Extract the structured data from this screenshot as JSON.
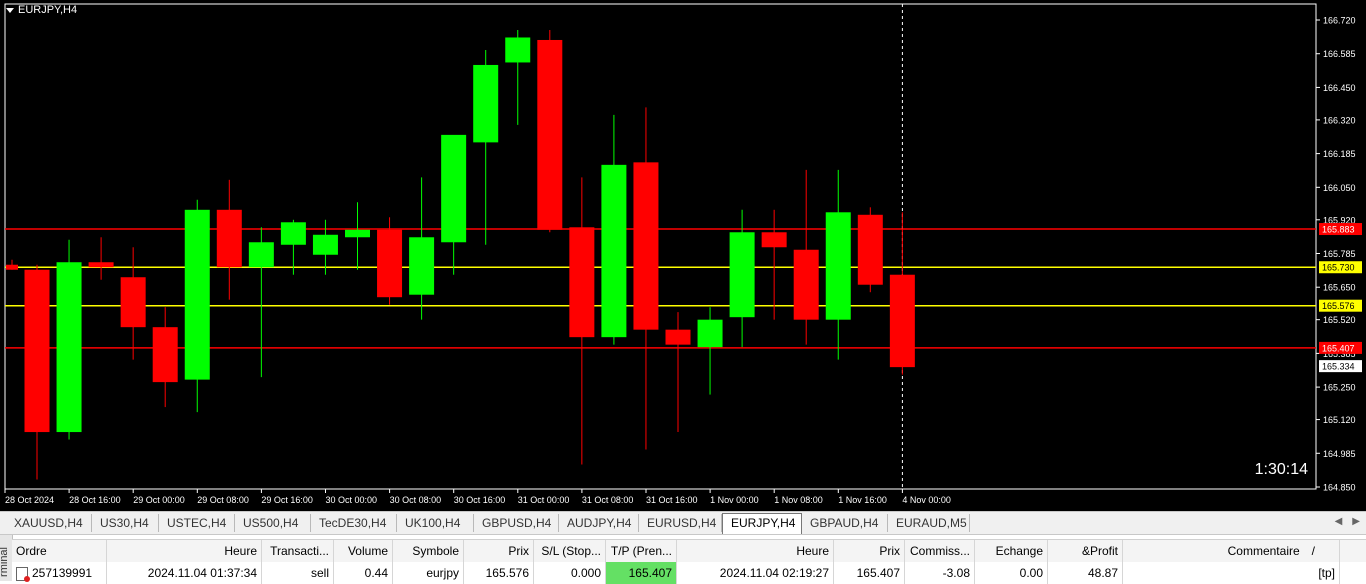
{
  "chart": {
    "symbol": "EURJPY,H4",
    "timer": "1:30:14",
    "price_axis": [
      "166.720",
      "166.585",
      "166.450",
      "166.320",
      "166.185",
      "166.050",
      "165.920",
      "165.785",
      "165.650",
      "165.520",
      "165.385",
      "165.250",
      "165.120",
      "164.985",
      "164.850"
    ],
    "x_labels": [
      "28 Oct 2024",
      "28 Oct 16:00",
      "29 Oct 00:00",
      "29 Oct 08:00",
      "29 Oct 16:00",
      "30 Oct 00:00",
      "30 Oct 08:00",
      "30 Oct 16:00",
      "31 Oct 00:00",
      "31 Oct 08:00",
      "31 Oct 16:00",
      "1 Nov 00:00",
      "1 Nov 08:00",
      "1 Nov 16:00",
      "4 Nov 00:00"
    ],
    "levels": [
      {
        "value": 165.883,
        "label": "165.883",
        "color": "#ff0000",
        "label_bg": "#ff0000",
        "label_color": "#ffffff"
      },
      {
        "value": 165.73,
        "label": "165.730",
        "color": "#ffff00",
        "label_bg": "#ffff00",
        "label_color": "#000000"
      },
      {
        "value": 165.576,
        "label": "165.576",
        "color": "#ffff00",
        "label_bg": "#ffff00",
        "label_color": "#000000"
      },
      {
        "value": 165.407,
        "label": "165.407",
        "color": "#ff0000",
        "label_bg": "#ff0000",
        "label_color": "#ffffff"
      }
    ],
    "current_price": {
      "value": 165.334,
      "label": "165.334"
    },
    "colors": {
      "bull": "#00ff00",
      "bear": "#ff0000",
      "background": "#000000",
      "grid": "#ffffff"
    }
  },
  "chart_data": {
    "type": "candlestick",
    "series": [
      {
        "o": 165.74,
        "h": 165.76,
        "l": 165.72,
        "c": 165.72
      },
      {
        "o": 165.72,
        "h": 165.74,
        "l": 164.88,
        "c": 165.07
      },
      {
        "o": 165.07,
        "h": 165.84,
        "l": 165.04,
        "c": 165.75
      },
      {
        "o": 165.75,
        "h": 165.85,
        "l": 165.68,
        "c": 165.73
      },
      {
        "o": 165.69,
        "h": 165.81,
        "l": 165.36,
        "c": 165.49
      },
      {
        "o": 165.49,
        "h": 165.57,
        "l": 165.17,
        "c": 165.27
      },
      {
        "o": 165.28,
        "h": 166.0,
        "l": 165.15,
        "c": 165.96
      },
      {
        "o": 165.96,
        "h": 166.08,
        "l": 165.6,
        "c": 165.73
      },
      {
        "o": 165.73,
        "h": 165.89,
        "l": 165.29,
        "c": 165.83
      },
      {
        "o": 165.82,
        "h": 165.92,
        "l": 165.7,
        "c": 165.91
      },
      {
        "o": 165.78,
        "h": 165.92,
        "l": 165.7,
        "c": 165.86
      },
      {
        "o": 165.85,
        "h": 165.99,
        "l": 165.72,
        "c": 165.88
      },
      {
        "o": 165.88,
        "h": 165.93,
        "l": 165.58,
        "c": 165.61
      },
      {
        "o": 165.62,
        "h": 166.09,
        "l": 165.52,
        "c": 165.85
      },
      {
        "o": 165.83,
        "h": 166.15,
        "l": 165.7,
        "c": 166.26
      },
      {
        "o": 166.23,
        "h": 166.6,
        "l": 165.82,
        "c": 166.54
      },
      {
        "o": 166.55,
        "h": 166.68,
        "l": 166.3,
        "c": 166.65
      },
      {
        "o": 166.64,
        "h": 166.68,
        "l": 165.87,
        "c": 165.88
      },
      {
        "o": 165.89,
        "h": 166.09,
        "l": 164.94,
        "c": 165.45
      },
      {
        "o": 165.45,
        "h": 166.34,
        "l": 165.42,
        "c": 166.14
      },
      {
        "o": 166.15,
        "h": 166.37,
        "l": 165.0,
        "c": 165.48
      },
      {
        "o": 165.48,
        "h": 165.55,
        "l": 165.07,
        "c": 165.42
      },
      {
        "o": 165.41,
        "h": 165.57,
        "l": 165.22,
        "c": 165.52
      },
      {
        "o": 165.53,
        "h": 165.96,
        "l": 165.41,
        "c": 165.87
      },
      {
        "o": 165.87,
        "h": 165.96,
        "l": 165.52,
        "c": 165.81
      },
      {
        "o": 165.8,
        "h": 166.12,
        "l": 165.42,
        "c": 165.52
      },
      {
        "o": 165.52,
        "h": 166.12,
        "l": 165.36,
        "c": 165.95
      },
      {
        "o": 165.94,
        "h": 165.97,
        "l": 165.63,
        "c": 165.66
      },
      {
        "o": 165.7,
        "h": 165.95,
        "l": 165.3,
        "c": 165.33
      }
    ]
  },
  "tabs": [
    "XAUUSD,H4",
    "US30,H4",
    "USTEC,H4",
    "US500,H4",
    "TecDE30,H4",
    "UK100,H4",
    "GBPUSD,H4",
    "AUDJPY,H4",
    "EURUSD,H4",
    "EURJPY,H4",
    "GBPAUD,H4",
    "EURAUD,M5"
  ],
  "active_tab": "EURJPY,H4",
  "terminal": {
    "side_label": "rminal",
    "headers": [
      "Ordre",
      "Heure",
      "Transacti...",
      "Volume",
      "Symbole",
      "Prix",
      "S/L (Stop...",
      "T/P (Pren...",
      "Heure",
      "Prix",
      "Commiss...",
      "Echange",
      "&Profit",
      "Commentaire"
    ],
    "row": [
      "257139991",
      "2024.11.04 01:37:34",
      "sell",
      "0.44",
      "eurjpy",
      "165.576",
      "0.000",
      "165.407",
      "2024.11.04 02:19:27",
      "165.407",
      "-3.08",
      "0.00",
      "48.87",
      "[tp]"
    ],
    "sort_indicator": "/"
  }
}
